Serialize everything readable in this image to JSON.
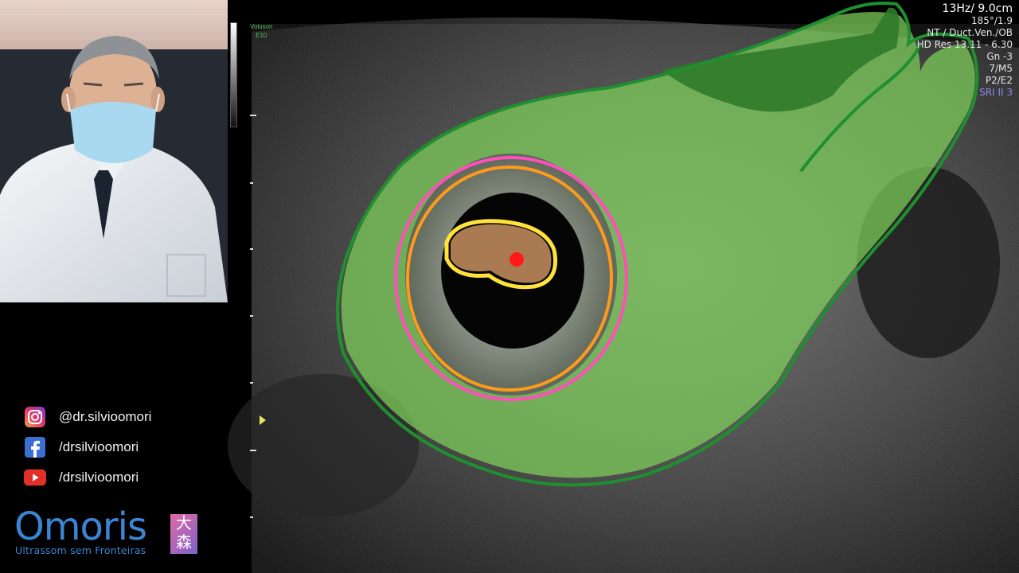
{
  "social": [
    {
      "network": "instagram",
      "icon": "instagram-icon",
      "handle": "@dr.silvioomori"
    },
    {
      "network": "facebook",
      "icon": "facebook-icon",
      "handle": "/drsilvioomori"
    },
    {
      "network": "youtube",
      "icon": "youtube-icon",
      "handle": "/drsilvioomori"
    }
  ],
  "brand": {
    "name": "Omoris",
    "kanji_1": "大",
    "kanji_2": "森",
    "tagline": "Ultrassom sem Fronteiras"
  },
  "scanner": {
    "logo_line1": "Voluson",
    "logo_line2": "E10"
  },
  "params": [
    "13Hz/ 9.0cm",
    "185°/1.9",
    "NT / Duct.Ven./OB",
    "HD Res 13.11 - 6.30",
    "Gn  -3",
    "7/M5",
    "P2/E2",
    "SRI II 3"
  ],
  "colors": {
    "uterus_outline": "#1f8f2f",
    "uterus_fill": "#7ed05a",
    "sac_outer": "#ff4fb8",
    "sac_inner": "#ff9a1a",
    "embryo_outline": "#ffe23a",
    "embryo_fill": "#c89060",
    "heartbeat": "#ff1a1a",
    "brand_blue": "#3a86d4"
  }
}
